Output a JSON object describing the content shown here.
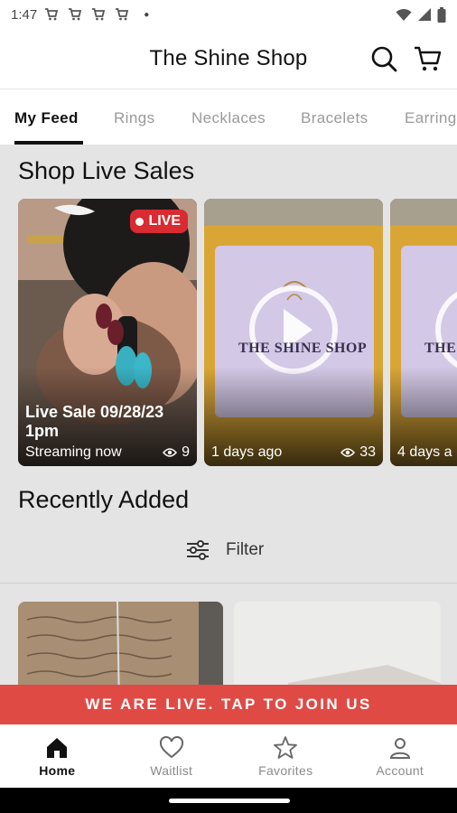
{
  "status_bar": {
    "time": "1:47"
  },
  "header": {
    "title": "The Shine Shop"
  },
  "tabs": [
    {
      "label": "My Feed",
      "active": true
    },
    {
      "label": "Rings",
      "active": false
    },
    {
      "label": "Necklaces",
      "active": false
    },
    {
      "label": "Bracelets",
      "active": false
    },
    {
      "label": "Earrings",
      "active": false
    }
  ],
  "live_sales": {
    "heading": "Shop Live Sales",
    "cards": [
      {
        "title": "Live Sale 09/28/23\n1pm",
        "status": "Streaming now",
        "views": "9",
        "badge": "LIVE"
      },
      {
        "title": "",
        "status": "1 days ago",
        "views": "33",
        "overlay_text": "THE SHINE SHOP"
      },
      {
        "title": "",
        "status": "4 days a",
        "views": "",
        "overlay_text": "THE SHINE SHOP"
      }
    ]
  },
  "recently_added": {
    "heading": "Recently Added",
    "filter_label": "Filter"
  },
  "banner": {
    "text": "WE ARE LIVE. TAP TO JOIN US"
  },
  "bottom_nav": [
    {
      "label": "Home",
      "icon": "home-icon",
      "active": true
    },
    {
      "label": "Waitlist",
      "icon": "heart-icon",
      "active": false
    },
    {
      "label": "Favorites",
      "icon": "star-icon",
      "active": false
    },
    {
      "label": "Account",
      "icon": "person-icon",
      "active": false
    }
  ],
  "colors": {
    "live_red": "#d92b32",
    "banner_red": "#e04a45",
    "mustard": "#d9a636",
    "lavender": "#d3c8e6"
  }
}
